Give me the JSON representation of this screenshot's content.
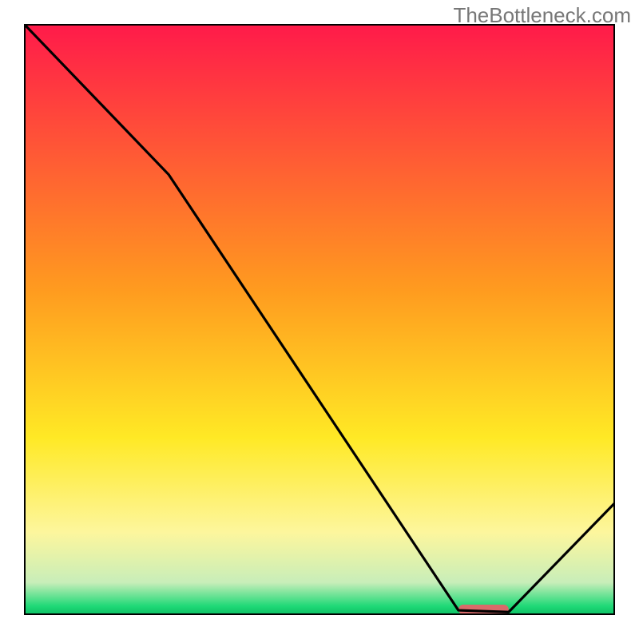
{
  "watermark": "TheBottleneck.com",
  "chart_data": {
    "type": "line",
    "title": "",
    "xlabel": "",
    "ylabel": "",
    "xlim": [
      0,
      100
    ],
    "ylim": [
      0,
      100
    ],
    "note": "Axes have no tick labels; values below are read off as fractions of the 0–100 plot area. The shaded red bar on the x-axis marks the optimal/no-bottleneck zone.",
    "curve_points": [
      {
        "x": 0.0,
        "y": 100.0
      },
      {
        "x": 24.5,
        "y": 74.5
      },
      {
        "x": 73.5,
        "y": 0.8
      },
      {
        "x": 82.0,
        "y": 0.5
      },
      {
        "x": 100.0,
        "y": 19.0
      }
    ],
    "optimal_zone": {
      "x_start": 73.5,
      "x_end": 82.0
    },
    "background_gradient_stops": [
      {
        "offset": 0.0,
        "color": "#ff1a4a"
      },
      {
        "offset": 0.45,
        "color": "#ff9b1f"
      },
      {
        "offset": 0.7,
        "color": "#ffe925"
      },
      {
        "offset": 0.86,
        "color": "#fdf69d"
      },
      {
        "offset": 0.945,
        "color": "#c8eeb9"
      },
      {
        "offset": 0.985,
        "color": "#1fd977"
      },
      {
        "offset": 1.0,
        "color": "#0cbf63"
      }
    ],
    "border_color": "#000000",
    "curve_color": "#000000",
    "zone_bar_color": "#d96a6a"
  }
}
